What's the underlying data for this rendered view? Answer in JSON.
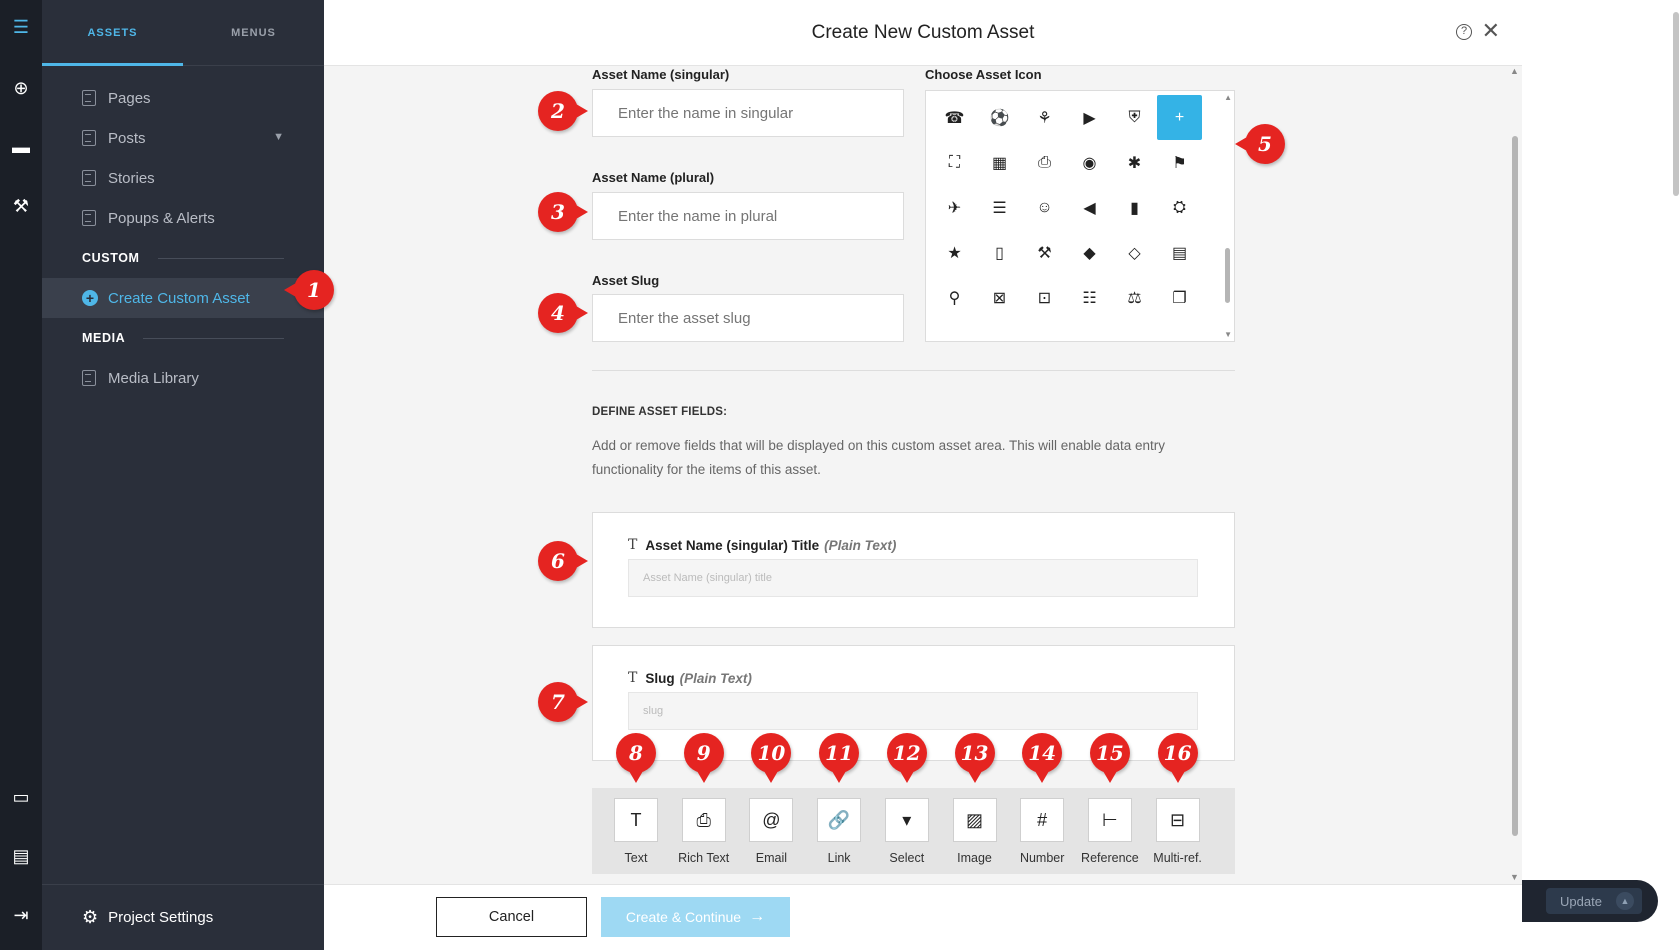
{
  "sidebar": {
    "tabs": [
      "ASSETS",
      "MENUS"
    ],
    "items": {
      "pages": "Pages",
      "posts": "Posts",
      "stories": "Stories",
      "popups": "Popups & Alerts",
      "create_custom_asset": "Create Custom Asset",
      "media_library": "Media Library"
    },
    "sections": {
      "custom": "CUSTOM",
      "media": "MEDIA"
    },
    "footer": "Project Settings"
  },
  "header": {
    "title": "Create New Custom Asset",
    "help": "?"
  },
  "form": {
    "singular": {
      "label": "Asset Name (singular)",
      "placeholder": "Enter the name in singular"
    },
    "plural": {
      "label": "Asset Name (plural)",
      "placeholder": "Enter the name in plural"
    },
    "slug": {
      "label": "Asset Slug",
      "placeholder": "Enter the asset slug"
    },
    "icon_label": "Choose Asset Icon"
  },
  "icons": {
    "selected": "plus-circle",
    "glyphs": [
      "☎",
      "⚽",
      "⚘",
      "▶",
      "⛨",
      "+",
      "⛶",
      "▦",
      "⎙",
      "◉",
      "✱",
      "⚑",
      "✈",
      "☰",
      "☺",
      "◀",
      "▮",
      "⛭",
      "★",
      "▯",
      "⚒",
      "◆",
      "◇",
      "▤",
      "⚲",
      "⊠",
      "⊡",
      "☷",
      "⚖",
      "❐"
    ]
  },
  "define": {
    "title": "DEFINE ASSET FIELDS:",
    "description": "Add or remove fields that will be displayed on this custom asset area. This will enable data entry functionality for the items of this asset."
  },
  "fields": [
    {
      "name": "Asset Name (singular) Title",
      "type": "(Plain Text)",
      "placeholder": "Asset Name (singular) title"
    },
    {
      "name": "Slug",
      "type": "(Plain Text)",
      "placeholder": "slug"
    }
  ],
  "toolbar": {
    "tools": [
      "Text",
      "Rich Text",
      "Email",
      "Link",
      "Select",
      "Image",
      "Number",
      "Reference",
      "Multi-ref."
    ],
    "glyphs": [
      "T",
      "⎙",
      "@",
      "🔗",
      "▾",
      "▨",
      "#",
      "⊢",
      "⊟"
    ]
  },
  "footer": {
    "cancel": "Cancel",
    "create": "Create & Continue",
    "create_arrow": "→"
  },
  "update": {
    "label": "Update",
    "arrow": "▲"
  },
  "callouts": [
    "1",
    "2",
    "3",
    "4",
    "5",
    "6",
    "7",
    "8",
    "9",
    "10",
    "11",
    "12",
    "13",
    "14",
    "15",
    "16"
  ],
  "colors": {
    "accent": "#34b3e6",
    "sidebar": "#2a2f3a",
    "callout": "#e52421"
  }
}
